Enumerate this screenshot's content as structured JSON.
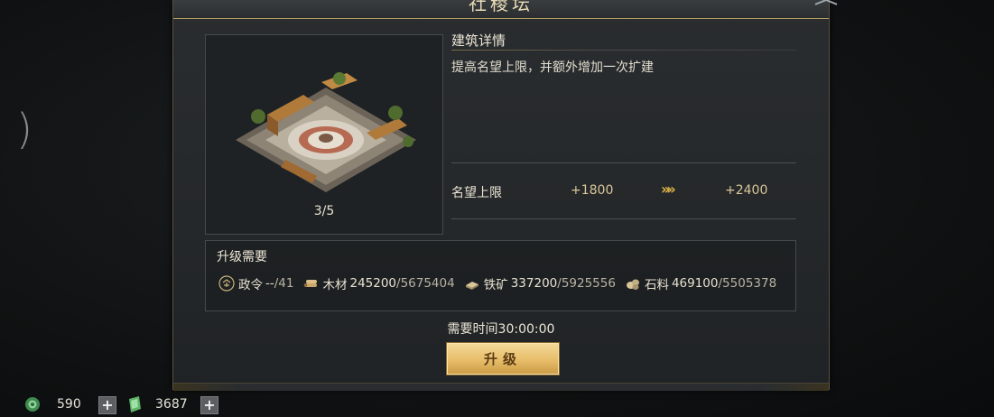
{
  "left_glyph": ")",
  "panel": {
    "title": "社稷坛",
    "building_image": {
      "level": "3/5"
    },
    "details": {
      "heading": "建筑详情",
      "description": "提高名望上限，并额外增加一次扩建",
      "stat": {
        "label": "名望上限",
        "current": "+1800",
        "arrow": "»»",
        "next": "+2400"
      }
    },
    "requirements": {
      "heading": "升级需要",
      "items": [
        {
          "icon": "decree-icon",
          "name": "政令",
          "have": "--",
          "need": "/41"
        },
        {
          "icon": "wood-icon",
          "name": "木材",
          "have": "245200",
          "need": "/5675404"
        },
        {
          "icon": "iron-ore-icon",
          "name": "铁矿",
          "have": "337200",
          "need": "/5925556"
        },
        {
          "icon": "stone-icon",
          "name": "石料",
          "have": "469100",
          "need": "/5505378"
        }
      ]
    },
    "time_required": "需要时间30:00:00",
    "upgrade_label": "升级"
  },
  "bottom_bar": {
    "jade": {
      "icon": "jade-icon",
      "value": "590"
    },
    "token": {
      "icon": "green-token-icon",
      "value": "3687"
    }
  },
  "colors": {
    "accent_gold": "#e7bd69",
    "panel_bg": "#25282a",
    "border": "#474a4c"
  }
}
